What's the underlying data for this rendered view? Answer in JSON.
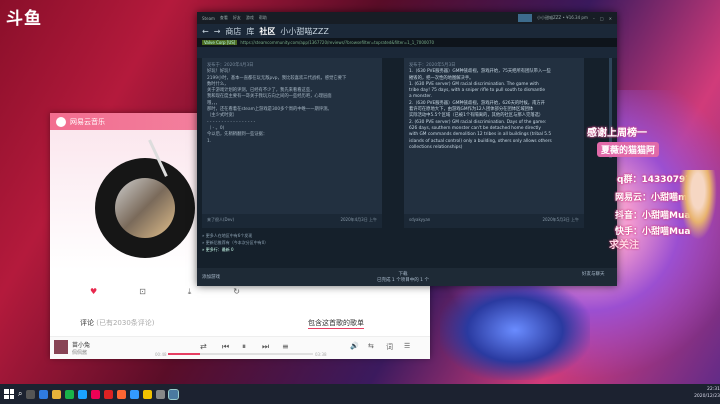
{
  "desktop": {
    "logo": "斗鱼"
  },
  "music": {
    "app_title": "网易云音乐",
    "comment_tab": "评论",
    "comment_sub": "(已有2030条评论)",
    "playlist_tab": "包含这首歌的歌单",
    "song_title": "苗小兔",
    "song_artist": "佩佩酱",
    "time_current": "00:48",
    "time_total": "03:38",
    "progress": 0.22
  },
  "steam": {
    "menu": [
      "Steam",
      "查看",
      "好友",
      "游戏",
      "帮助"
    ],
    "user": "小小甜喵ZZZ • ¥16.34 pm",
    "nav": {
      "store": "商店",
      "library": "库",
      "community": "社区",
      "user": "小小甜喵ZZZ"
    },
    "url_lock": "Valve Corp [US]",
    "url": "https://steamcommunity.com/app/1367720/reviews/?browsefilter=toprated&filter=1_1_7000070",
    "left_review": {
      "date": "发布于：2020年4月3日",
      "lines": [
        "好玩！好玩！",
        "2199小时，基本一直都在玩无敌pvp，我比较喜欢三代战机，感觉它要下",
        "数时什么，",
        "关于游戏计划的评测，已经有不少了，我先来看看这些，",
        "我和现在度主要有一哥关于我玩方向之间的一些经历吧，心理层面",
        "哦，，，",
        "那时，还在看着在steam上游戏是300多个周的中唯一一期评测。",
        "（主少式时宽）",
        "- - - - - - - - - - - - - - - - -",
        "（ - 。0)",
        "今以后，先稍稍翻到一些证据：",
        "1."
      ],
      "footer": "来了很人(Dev)",
      "footer_date": "2020年4月3日 上午"
    },
    "right_review": {
      "date": "发布于：2020年5月3日",
      "lines": [
        "1.（630 PVE服务器）GM种族歧视，游戏开始，75天把所有团队带入一些",
        "摧毁的，把一次性的地图解决手。",
        "1. (630 PVE server) GM racial discrimination. The game with",
        "tribe day! 75 days, with a sniper rifle to pull south to dismantle",
        "a monster.",
        "2.（630 PVE服务器）GM种族歧视，游戏开始，626天的时候，南方开",
        "着许可在原地大下，由游戏GM作为12人团体部分在团体区域团体",
        "实际活动中5.5个区域（已被1个有隔离的，其他的社区与那人完落选）",
        "2. (630 PVE server) GM racial discrimination. Days of the game:",
        "626 days, southern monster can't be detached home directly",
        "with GM commands demolition 12 tribes in all buildings (tribal 5.5",
        "islands of actual control) only a building, others only allows others",
        "collections relationships)"
      ],
      "footer": "sdyakyyan",
      "footer_date": "2020年5月3日 上午"
    },
    "more_list": [
      "» 更多人在地区中有6个发现",
      "» 更新后推荐有（今本次分区中有0）",
      "» 更多行：最新 0"
    ],
    "bottom": {
      "add_game": "添加游戏",
      "download": "下载",
      "download_sub": "已完成 1 个项目中的 1 个",
      "friends": "好友与聊天"
    }
  },
  "overlay": {
    "title": "感谢上周榜一",
    "highlight": "夏薇的猫猫阿",
    "qq": "q群：143307976",
    "netease": "网易云：小甜喵mua",
    "douyin": "抖音：小甜喵Mua",
    "kuaishou": "快手：小甜喵Mua",
    "cta": "求关注"
  },
  "taskbar": {
    "time": "22:31",
    "date": "2020/12/23"
  }
}
